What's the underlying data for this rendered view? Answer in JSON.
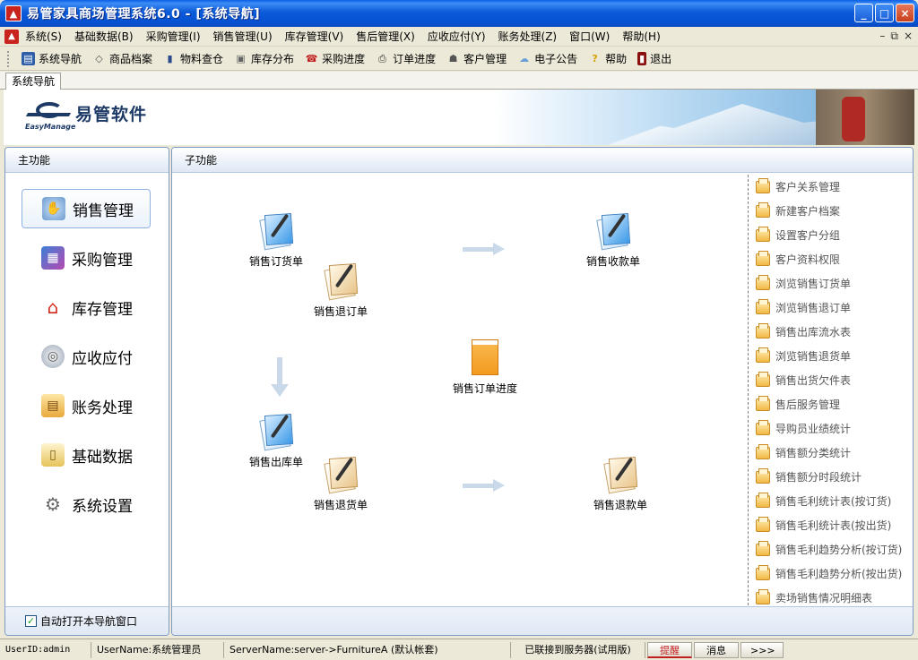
{
  "window": {
    "title": "易管家具商场管理系统6.0 - [系统导航]",
    "controls": [
      "_",
      "□",
      "×"
    ]
  },
  "menubar": {
    "items": [
      "系统(S)",
      "基础数据(B)",
      "采购管理(I)",
      "销售管理(U)",
      "库存管理(V)",
      "售后管理(X)",
      "应收应付(Y)",
      "账务处理(Z)",
      "窗口(W)",
      "帮助(H)"
    ],
    "mdi_controls": [
      "–",
      "⧉",
      "×"
    ]
  },
  "toolbar": {
    "items": [
      {
        "label": "系统导航",
        "icon": "nav-icon"
      },
      {
        "label": "商品档案",
        "icon": "tag-icon"
      },
      {
        "label": "物料查仓",
        "icon": "chart-icon"
      },
      {
        "label": "库存分布",
        "icon": "document-icon"
      },
      {
        "label": "采购进度",
        "icon": "phone-icon"
      },
      {
        "label": "订单进度",
        "icon": "printer-icon"
      },
      {
        "label": "客户管理",
        "icon": "people-icon"
      },
      {
        "label": "电子公告",
        "icon": "cloud-icon"
      },
      {
        "label": "帮助",
        "icon": "help-icon"
      },
      {
        "label": "退出",
        "icon": "exit-icon"
      }
    ]
  },
  "tabs": [
    {
      "label": "系统导航"
    }
  ],
  "banner": {
    "logo_en": "EasyManage",
    "logo_cn": "易管软件"
  },
  "main_panel": {
    "header": "主功能",
    "items": [
      {
        "label": "销售管理",
        "icon": "handshake-icon",
        "active": true
      },
      {
        "label": "采购管理",
        "icon": "purchase-icon",
        "active": false
      },
      {
        "label": "库存管理",
        "icon": "house-icon",
        "active": false
      },
      {
        "label": "应收应付",
        "icon": "coins-icon",
        "active": false
      },
      {
        "label": "账务处理",
        "icon": "ledger-icon",
        "active": false
      },
      {
        "label": "基础数据",
        "icon": "database-icon",
        "active": false
      },
      {
        "label": "系统设置",
        "icon": "gears-icon",
        "active": false
      }
    ],
    "footer_checkbox": {
      "label": "自动打开本导航窗口",
      "checked": true
    }
  },
  "sub_panel": {
    "header": "子功能",
    "flow_nodes": [
      {
        "label": "销售订货单",
        "icon": "sales-order-icon"
      },
      {
        "label": "销售退订单",
        "icon": "sales-cancel-icon"
      },
      {
        "label": "销售收款单",
        "icon": "sales-receipt-icon"
      },
      {
        "label": "销售订单进度",
        "icon": "order-progress-icon"
      },
      {
        "label": "销售出库单",
        "icon": "sales-outbound-icon"
      },
      {
        "label": "销售退货单",
        "icon": "sales-return-icon"
      },
      {
        "label": "销售退款单",
        "icon": "sales-refund-icon"
      }
    ],
    "list": [
      "客户关系管理",
      "新建客户档案",
      "设置客户分组",
      "客户资料权限",
      "浏览销售订货单",
      "浏览销售退订单",
      "销售出库流水表",
      "浏览销售退货单",
      "销售出货欠件表",
      "售后服务管理",
      "导购员业绩统计",
      "销售额分类统计",
      "销售额分时段统计",
      "销售毛利统计表(按订货)",
      "销售毛利统计表(按出货)",
      "销售毛利趋势分析(按订货)",
      "销售毛利趋势分析(按出货)",
      "卖场销售情况明细表"
    ]
  },
  "statusbar": {
    "user_id": "UserID:admin",
    "user_name": "UserName:系统管理员",
    "server": "ServerName:server->FurnitureA (默认帐套)",
    "connection": "已联接到服务器(试用版)",
    "remind": "提醒",
    "message": "消息",
    "more": ">>>"
  },
  "colors": {
    "titlebar": "#0653d3",
    "panel_border": "#7d9bc4",
    "accent_red": "#c8231d",
    "status_alert": "#c02020"
  }
}
